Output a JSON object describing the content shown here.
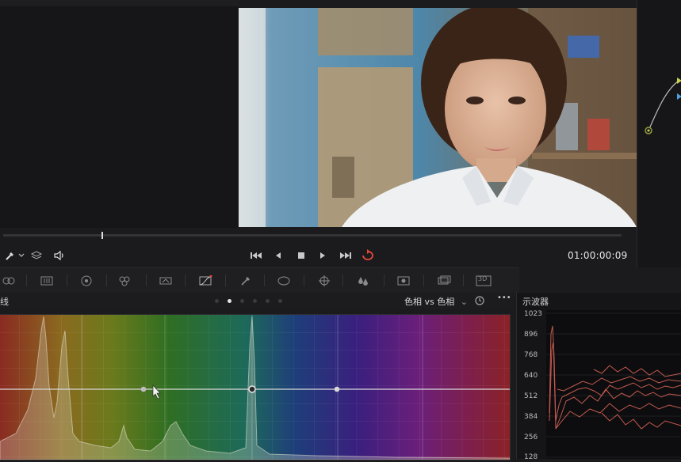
{
  "transport": {
    "timecode": "01:00:00:09"
  },
  "curves": {
    "title": "线",
    "mode": "色相 vs 色相",
    "mode_chevron": "⌄",
    "more": "•••",
    "page_dots_total": 6,
    "page_dot_active": 1
  },
  "toolbar": {
    "badge_3d": "3D"
  },
  "scope": {
    "title": "示波器",
    "y_labels": [
      "1023",
      "896",
      "768",
      "640",
      "512",
      "384",
      "256",
      "128"
    ]
  },
  "icons": {
    "eyedropper": "eyedropper-icon",
    "layers": "layers-icon",
    "speaker": "speaker-icon",
    "skip_back": "skip-back-icon",
    "prev": "prev-frame-icon",
    "stop": "stop-icon",
    "play": "play-icon",
    "skip_fwd": "skip-forward-icon",
    "loop": "loop-icon"
  },
  "colors": {
    "accent_loop": "#e2483a",
    "panel_bg": "#1b1b1d",
    "scope_trace": "#e2685a"
  }
}
